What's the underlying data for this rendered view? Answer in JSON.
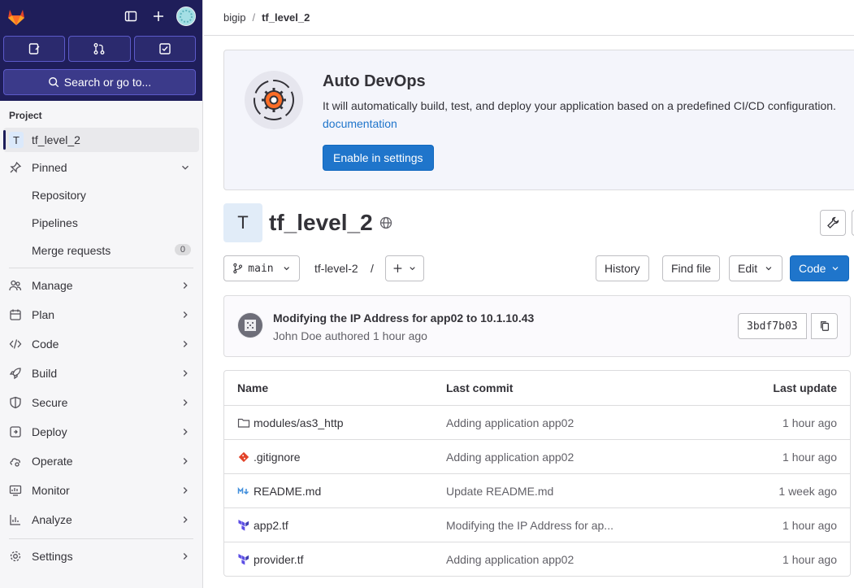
{
  "sidebar": {
    "section_title": "Project",
    "search_label": "Search or go to...",
    "project": {
      "initial": "T",
      "name": "tf_level_2"
    },
    "pinned": {
      "label": "Pinned",
      "items": [
        {
          "label": "Repository"
        },
        {
          "label": "Pipelines"
        },
        {
          "label": "Merge requests",
          "count": "0"
        }
      ]
    },
    "menu": [
      {
        "label": "Manage",
        "icon": "users-icon"
      },
      {
        "label": "Plan",
        "icon": "calendar-icon"
      },
      {
        "label": "Code",
        "icon": "code-icon"
      },
      {
        "label": "Build",
        "icon": "rocket-icon"
      },
      {
        "label": "Secure",
        "icon": "shield-icon"
      },
      {
        "label": "Deploy",
        "icon": "deploy-icon"
      },
      {
        "label": "Operate",
        "icon": "cloud-gear-icon"
      },
      {
        "label": "Monitor",
        "icon": "monitor-icon"
      },
      {
        "label": "Analyze",
        "icon": "chart-icon"
      }
    ],
    "settings_label": "Settings"
  },
  "breadcrumb": {
    "group": "bigip",
    "project": "tf_level_2"
  },
  "devops": {
    "title": "Auto DevOps",
    "text": "It will automatically build, test, and deploy your application based on a predefined CI/CD configuration.",
    "link": "documentation",
    "button": "Enable in settings"
  },
  "project": {
    "initial": "T",
    "name": "tf_level_2"
  },
  "toolbar": {
    "branch": "main",
    "path": "tf-level-2",
    "path_sep": "/",
    "history": "History",
    "find_file": "Find file",
    "edit": "Edit",
    "code": "Code"
  },
  "commit": {
    "title": "Modifying the IP Address for app02 to 10.1.10.43",
    "meta": "John Doe authored 1 hour ago",
    "sha": "3bdf7b03"
  },
  "files": {
    "headers": {
      "name": "Name",
      "commit": "Last commit",
      "date": "Last update"
    },
    "rows": [
      {
        "name": "modules/as3_http",
        "icon": "folder-icon",
        "commit": "Adding application app02",
        "date": "1 hour ago"
      },
      {
        "name": ".gitignore",
        "icon": "git-icon",
        "commit": "Adding application app02",
        "date": "1 hour ago"
      },
      {
        "name": "README.md",
        "icon": "markdown-icon",
        "commit": "Update README.md",
        "date": "1 week ago"
      },
      {
        "name": "app2.tf",
        "icon": "terraform-icon",
        "commit": "Modifying the IP Address for ap...",
        "date": "1 hour ago"
      },
      {
        "name": "provider.tf",
        "icon": "terraform-icon",
        "commit": "Adding application app02",
        "date": "1 hour ago"
      }
    ]
  },
  "colors": {
    "brand": "#1f1e5a",
    "accent": "#1f75cb",
    "gitlab_orange": "#e24329"
  }
}
